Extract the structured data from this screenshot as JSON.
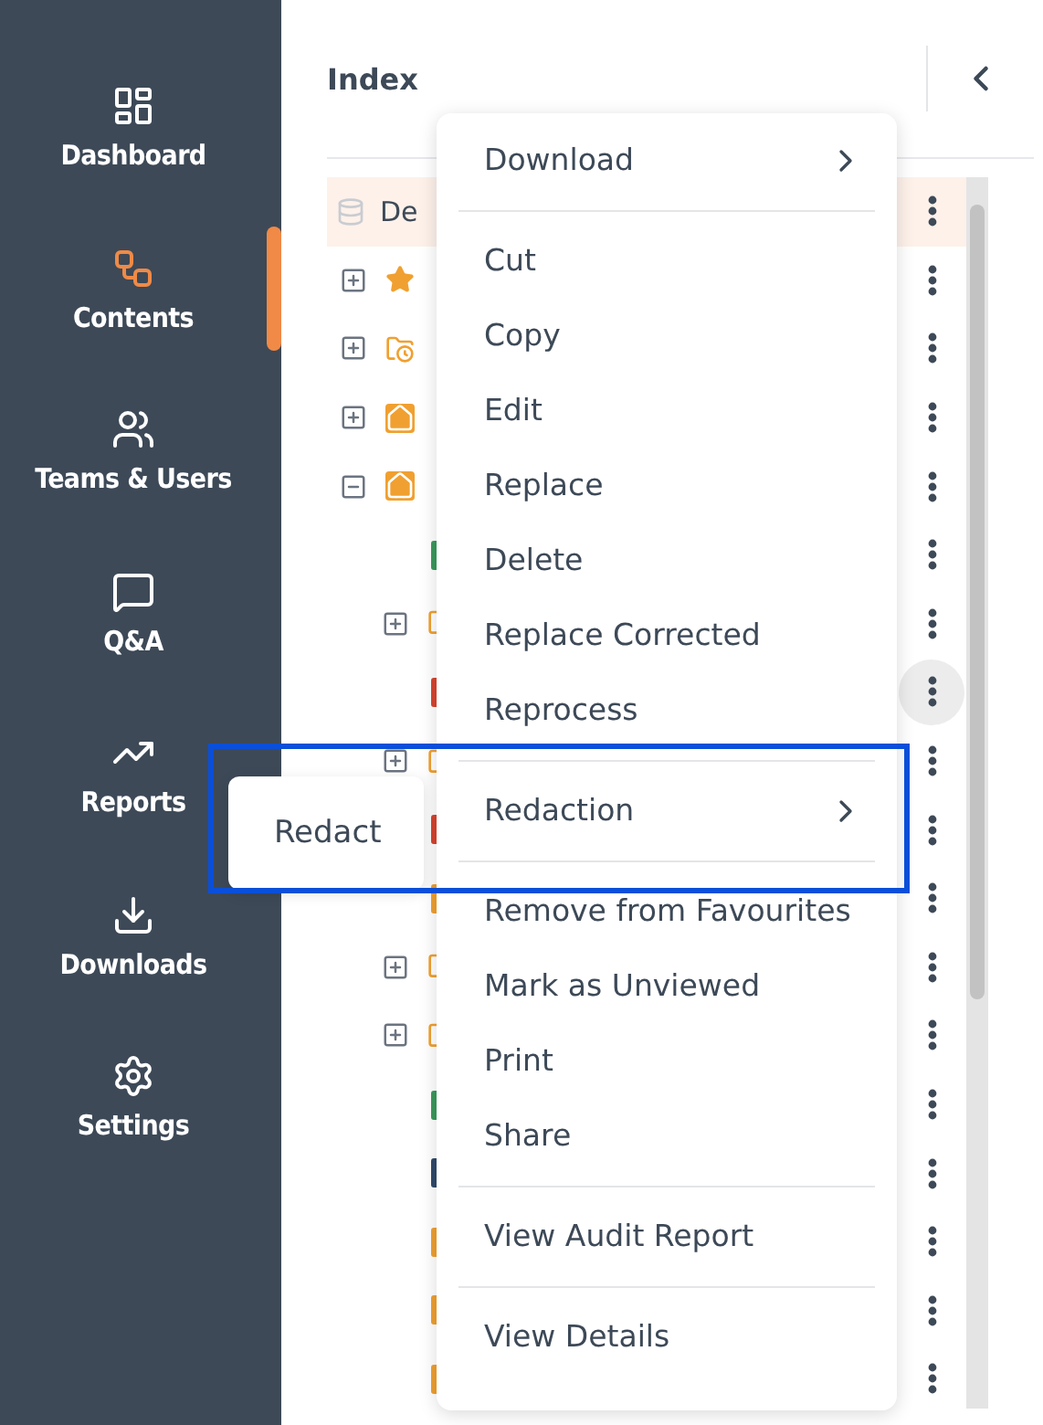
{
  "sidebar": {
    "items": [
      {
        "label": "Dashboard",
        "selected": false
      },
      {
        "label": "Contents",
        "selected": true
      },
      {
        "label": "Teams & Users",
        "selected": false
      },
      {
        "label": "Q&A",
        "selected": false
      },
      {
        "label": "Reports",
        "selected": false
      },
      {
        "label": "Downloads",
        "selected": false
      },
      {
        "label": "Settings",
        "selected": false
      }
    ]
  },
  "index_panel": {
    "title": "Index",
    "tree": [
      {
        "kind": "database",
        "label": "De",
        "selected": true,
        "children": [
          {
            "kind": "favourites",
            "expanded": false
          },
          {
            "kind": "recent-folder",
            "expanded": false
          },
          {
            "kind": "home-folder",
            "expanded": false
          },
          {
            "kind": "home-folder",
            "expanded": true,
            "children": [
              {
                "kind": "file",
                "color": "#3a9a5c"
              },
              {
                "kind": "folder",
                "expanded": false
              },
              {
                "kind": "file",
                "color": "#d9442f"
              },
              {
                "kind": "folder",
                "expanded": false
              },
              {
                "kind": "file",
                "color": "#d9442f"
              },
              {
                "kind": "file",
                "color": "#f0a030"
              },
              {
                "kind": "folder",
                "expanded": false
              },
              {
                "kind": "folder",
                "expanded": false
              },
              {
                "kind": "file",
                "color": "#3a9a5c"
              },
              {
                "kind": "file",
                "color": "#2f4a6b"
              },
              {
                "kind": "file",
                "color": "#f0a030"
              },
              {
                "kind": "file",
                "color": "#f0a030"
              },
              {
                "kind": "file",
                "color": "#f0a030"
              }
            ]
          }
        ]
      }
    ]
  },
  "context_menu": {
    "groups": [
      [
        {
          "label": "Download",
          "kind": "submenu"
        }
      ],
      [
        {
          "label": "Cut",
          "kind": "action"
        },
        {
          "label": "Copy",
          "kind": "action"
        },
        {
          "label": "Edit",
          "kind": "action"
        },
        {
          "label": "Replace",
          "kind": "action"
        },
        {
          "label": "Delete",
          "kind": "action"
        },
        {
          "label": "Replace Corrected",
          "kind": "action"
        },
        {
          "label": "Reprocess",
          "kind": "action"
        }
      ],
      [
        {
          "label": "Redaction",
          "kind": "submenu"
        }
      ],
      [
        {
          "label": "Remove from Favourites",
          "kind": "action"
        },
        {
          "label": "Mark as Unviewed",
          "kind": "action"
        },
        {
          "label": "Print",
          "kind": "action"
        },
        {
          "label": "Share",
          "kind": "action"
        }
      ],
      [
        {
          "label": "View Audit Report",
          "kind": "action"
        }
      ],
      [
        {
          "label": "View Details",
          "kind": "action"
        }
      ]
    ],
    "submenu": {
      "items": [
        "Redact"
      ]
    }
  }
}
